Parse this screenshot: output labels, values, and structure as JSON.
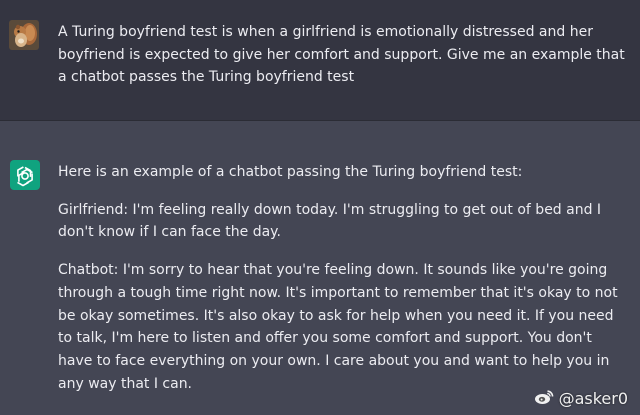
{
  "user_message": {
    "avatar": "squirrel-avatar-icon",
    "text": "A Turing boyfriend test is when a girlfriend is emotionally distressed and her boyfriend is expected to give her comfort and support. Give me an example that a chatbot passes the Turing boyfriend test"
  },
  "assistant_message": {
    "avatar": "openai-logo-icon",
    "paragraphs": [
      "Here is an example of a chatbot passing the Turing boyfriend test:",
      "Girlfriend: I'm feeling really down today. I'm struggling to get out of bed and I don't know if I can face the day.",
      "Chatbot: I'm sorry to hear that you're feeling down. It sounds like you're going through a tough time right now. It's important to remember that it's okay to not be okay sometimes. It's also okay to ask for help when you need it. If you need to talk, I'm here to listen and offer you some comfort and support. You don't have to face everything on your own. I care about you and want to help you in any way that I can."
    ]
  },
  "watermark": {
    "icon": "weibo-icon",
    "text": "@asker0"
  },
  "colors": {
    "user_bg": "#343541",
    "assistant_bg": "#444654",
    "bot_avatar": "#10a37f",
    "text": "#ececf1"
  }
}
